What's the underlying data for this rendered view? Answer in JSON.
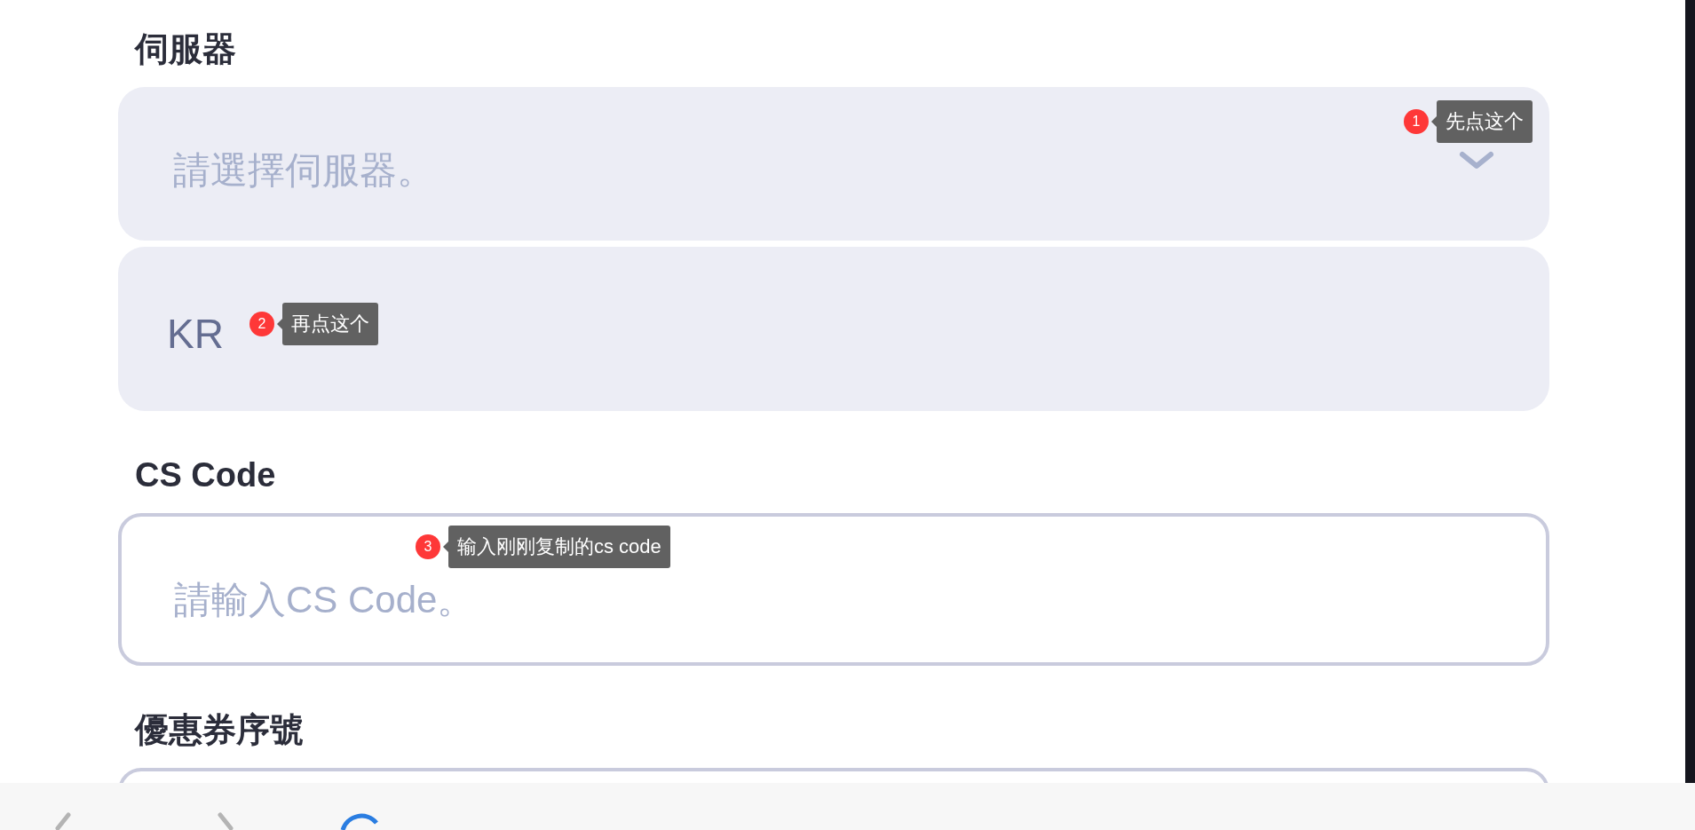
{
  "sections": [
    {
      "label": "伺服器",
      "fields": [
        {
          "kind": "select",
          "placeholder": "請選擇伺服器。",
          "hint": {
            "number": "1",
            "text": "先点这个"
          }
        },
        {
          "kind": "option",
          "text": "KR",
          "hint": {
            "number": "2",
            "text": "再点这个"
          }
        }
      ]
    },
    {
      "label": "CS Code",
      "fields": [
        {
          "kind": "input",
          "placeholder": "請輸入CS Code。",
          "hint": {
            "number": "3",
            "text": "输入刚刚复制的cs code"
          }
        }
      ]
    },
    {
      "label": "優惠券序號",
      "fields": [
        {
          "kind": "input"
        }
      ]
    }
  ]
}
